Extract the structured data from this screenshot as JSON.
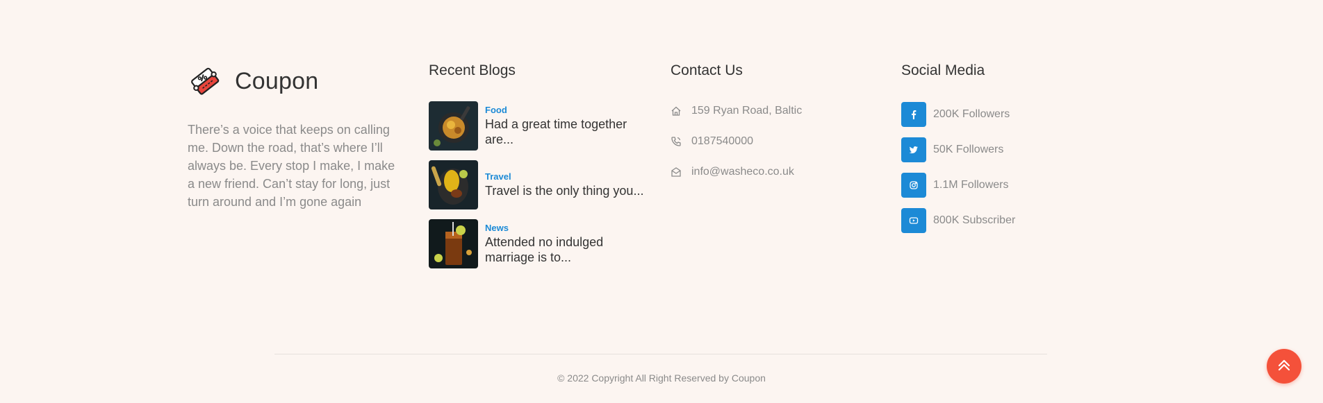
{
  "brand": {
    "name": "Coupon",
    "description": "There’s a voice that keeps on calling me. Down the road, that’s where I’ll always be. Every stop I make, I make a new friend. Can’t stay for long, just turn around and I’m gone again"
  },
  "blogs": {
    "title": "Recent Blogs",
    "items": [
      {
        "category": "Food",
        "title": "Had a great time together are...",
        "thumb": "food-plate-image"
      },
      {
        "category": "Travel",
        "title": "Travel is the only thing you...",
        "thumb": "lemon-dish-image"
      },
      {
        "category": "News",
        "title": "Attended no indulged marriage is to...",
        "thumb": "iced-drink-image"
      }
    ]
  },
  "contact": {
    "title": "Contact Us",
    "items": [
      {
        "icon": "home-icon",
        "text": "159 Ryan Road, Baltic"
      },
      {
        "icon": "phone-icon",
        "text": "0187540000"
      },
      {
        "icon": "mail-icon",
        "text": "info@washeco.co.uk"
      }
    ]
  },
  "social": {
    "title": "Social Media",
    "items": [
      {
        "icon": "facebook-icon",
        "text": "200K Followers"
      },
      {
        "icon": "twitter-icon",
        "text": "50K Followers"
      },
      {
        "icon": "instagram-icon",
        "text": "1.1M Followers"
      },
      {
        "icon": "youtube-icon",
        "text": "800K Subscriber"
      }
    ]
  },
  "footer": {
    "copyright": "© 2022 Copyright All Right Reserved by Coupon"
  },
  "colors": {
    "background": "#fcf5f1",
    "accent_blue": "#1c8ad6",
    "accent_red": "#f4513a"
  }
}
